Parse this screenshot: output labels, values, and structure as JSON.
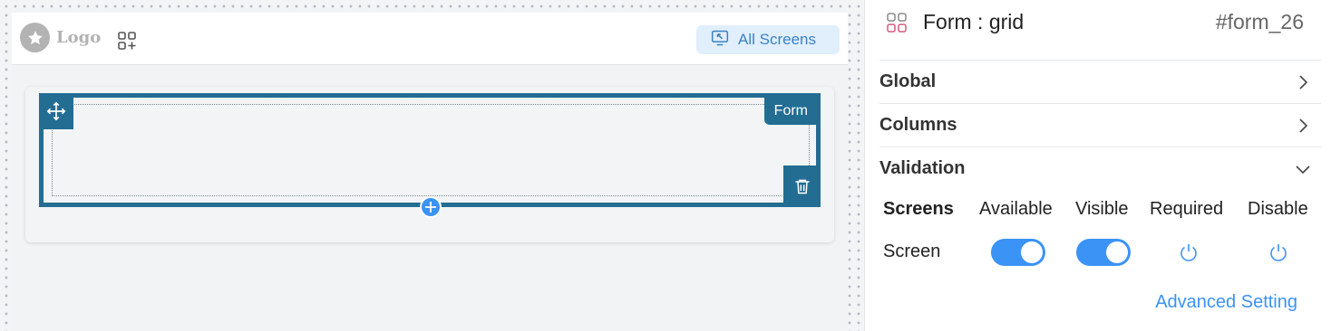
{
  "canvas": {
    "logo": {
      "text": "Logo",
      "icon": "star-icon"
    },
    "add_widget_icon": "grid-plus-icon",
    "all_screens_button": {
      "label": "All Screens",
      "icon": "screen-cursor-icon"
    },
    "form_block": {
      "tag": "Form",
      "move_icon": "move-arrows-icon",
      "delete_icon": "trash-icon",
      "add_icon": "plus-icon"
    }
  },
  "panel": {
    "header": {
      "icon": "grid-icon",
      "title": "Form : grid",
      "id": "#form_26"
    },
    "sections": [
      {
        "title": "Global",
        "state": "collapsed",
        "icon": "chevron-right-icon"
      },
      {
        "title": "Columns",
        "state": "collapsed",
        "icon": "chevron-right-icon"
      },
      {
        "title": "Validation",
        "state": "expanded",
        "icon": "chevron-down-icon"
      }
    ],
    "validation": {
      "columns": [
        "Screens",
        "Available",
        "Visible",
        "Required",
        "Disable"
      ],
      "rows": [
        {
          "screen": "Screen",
          "available": true,
          "visible": true,
          "required": false,
          "disable": false
        }
      ]
    },
    "advanced_link": "Advanced Setting"
  },
  "colors": {
    "form_frame": "#236d93",
    "accent_blue": "#3b93f5",
    "all_screens_bg": "#e1eefb",
    "all_screens_text": "#3b82c4"
  }
}
